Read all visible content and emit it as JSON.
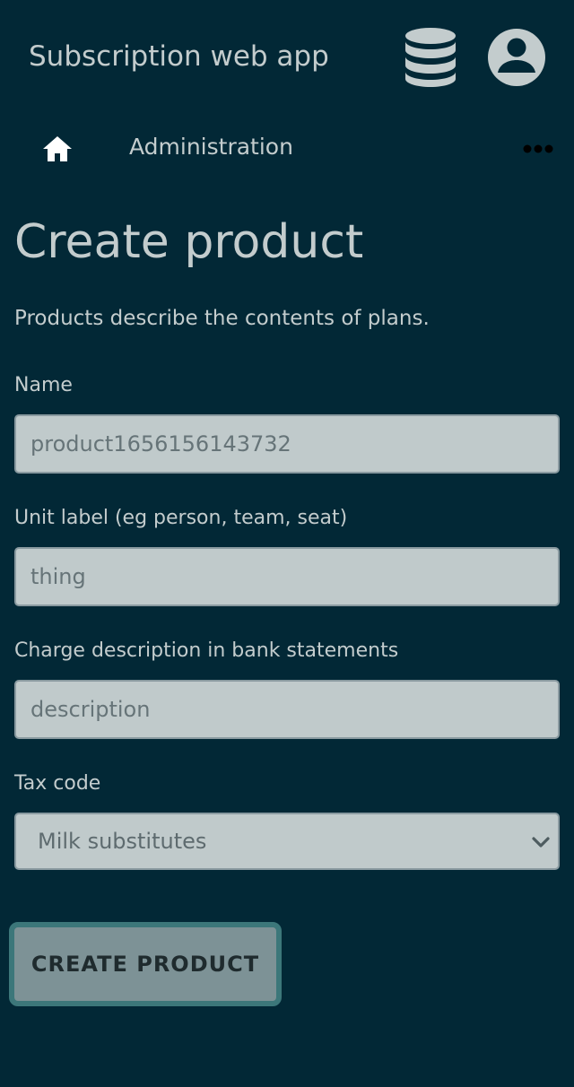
{
  "header": {
    "app_title": "Subscription web app",
    "icons": [
      "database-icon",
      "account-circle-icon"
    ]
  },
  "breadcrumb": {
    "home_icon": "home-icon",
    "section_label": "Administration",
    "more_icon": "more-horizontal-icon"
  },
  "page": {
    "title": "Create product",
    "description": "Products describe the contents of plans."
  },
  "form": {
    "name": {
      "label": "Name",
      "placeholder": "product1656156143732"
    },
    "unit_label": {
      "label": "Unit label (eg person, team, seat)",
      "placeholder": "thing"
    },
    "charge_description": {
      "label": "Charge description in bank statements",
      "placeholder": "description"
    },
    "tax_code": {
      "label": "Tax code",
      "selected": "Milk substitutes"
    },
    "submit_label": "CREATE PRODUCT"
  },
  "colors": {
    "background": "#022836",
    "text": "#c3cccd",
    "input_background": "#c0cacb",
    "button_background": "#7d9296",
    "button_border": "#3c777a"
  }
}
